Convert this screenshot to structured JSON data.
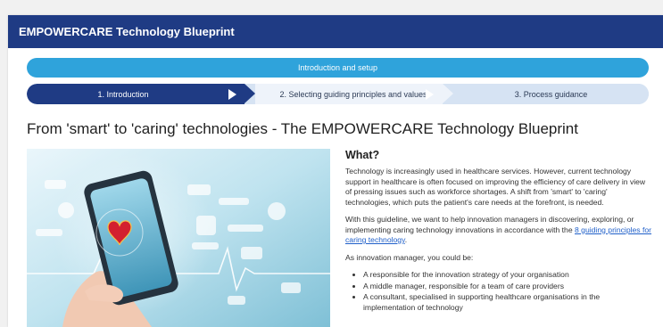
{
  "header": {
    "title": "EMPOWERCARE Technology Blueprint"
  },
  "section": {
    "label": "Introduction and setup"
  },
  "steps": [
    {
      "label": "1. Introduction"
    },
    {
      "label": "2. Selecting guiding principles and values"
    },
    {
      "label": "3. Process guidance"
    }
  ],
  "page": {
    "title": "From 'smart' to 'caring' technologies - The EMPOWERCARE Technology Blueprint"
  },
  "what": {
    "heading": "What?",
    "para1": "Technology is increasingly used in healthcare services. However, current technology support in healthcare is often focused on improving the efficiency of care delivery in view of pressing issues such as workforce shortages. A shift from 'smart' to 'caring' technologies, which puts the patient's care needs at the forefront, is needed.",
    "para2_before": "With this guideline, we want to help innovation managers in discovering, exploring, or implementing caring technology innovations in accordance with the ",
    "para2_link": "8 guiding principles for caring technology",
    "para2_after": ".",
    "para3": "As innovation manager, you could be:",
    "bullets": [
      "A responsible for the innovation strategy of your organisation",
      "A middle manager, responsible for a team of care providers",
      "A consultant, specialised in supporting healthcare organisations in the implementation of technology"
    ]
  },
  "colors": {
    "header_bg": "#1f3b84",
    "section_bar": "#2fa3db",
    "active_step": "#1f3b84",
    "inactive_step": "#d6e3f3",
    "link": "#1f5fc9"
  },
  "icons": [
    "play-arrow-icon",
    "heart-icon",
    "smartphone-icon",
    "hand-icon"
  ]
}
